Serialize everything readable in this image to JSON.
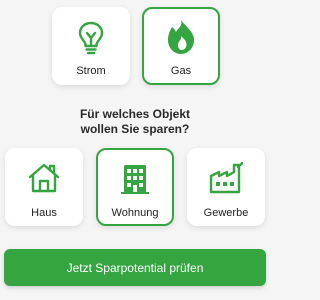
{
  "accent_color": "#35a541",
  "energy_options": [
    {
      "label": "Strom",
      "icon": "lightbulb-icon",
      "selected": false
    },
    {
      "label": "Gas",
      "icon": "flame-icon",
      "selected": true
    }
  ],
  "question": {
    "line1": "Für welches Objekt",
    "line2": "wollen Sie sparen?"
  },
  "object_options": [
    {
      "label": "Haus",
      "icon": "house-icon",
      "selected": false
    },
    {
      "label": "Wohnung",
      "icon": "apartment-building-icon",
      "selected": true
    },
    {
      "label": "Gewerbe",
      "icon": "factory-icon",
      "selected": false
    }
  ],
  "cta": {
    "label": "Jetzt Sparpotential prüfen"
  }
}
